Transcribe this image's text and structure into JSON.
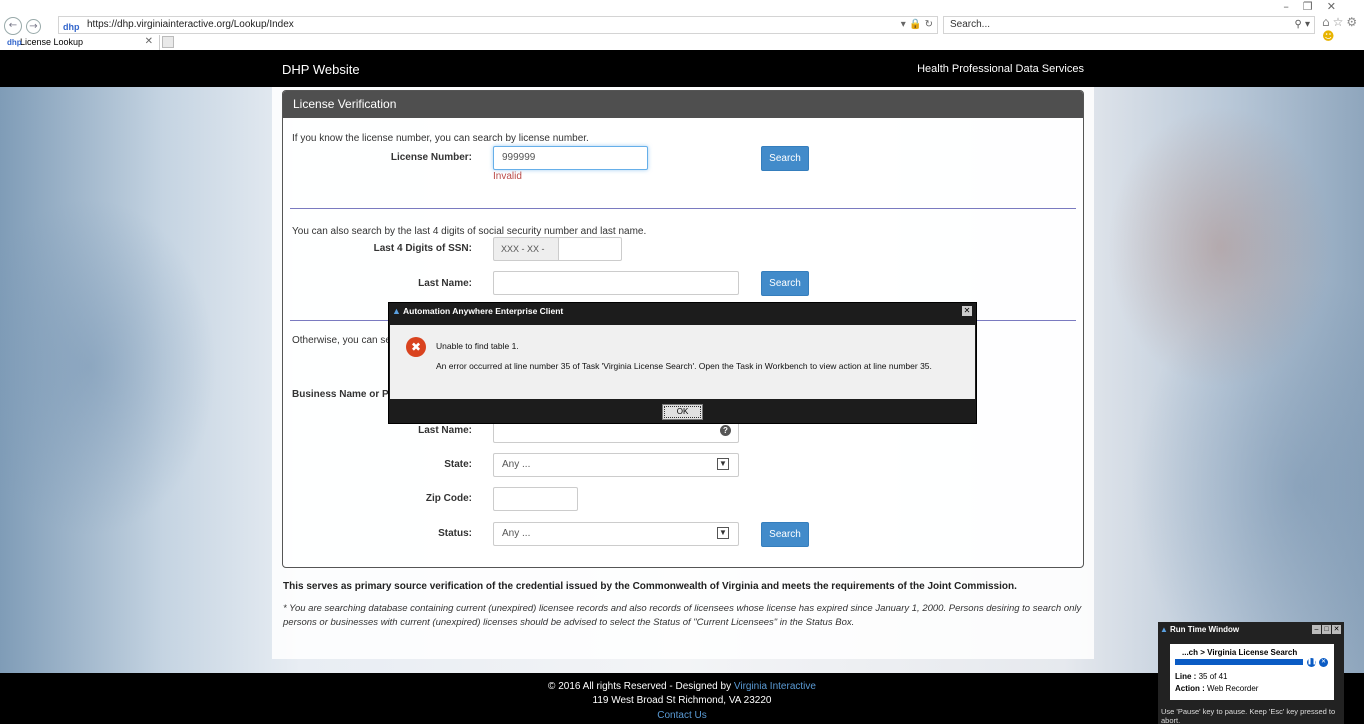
{
  "browser": {
    "url": "https://dhp.virginiainteractive.org/Lookup/Index",
    "search_placeholder": "Search...",
    "tab_title": "License Lookup"
  },
  "site": {
    "title": "DHP Website",
    "right_link": "Health Professional Data Services"
  },
  "form": {
    "heading": "License Verification",
    "section1_intro": "If you know the license number, you can search by license number.",
    "license_label": "License Number:",
    "license_value": "999999",
    "license_error": "Invalid",
    "search_label": "Search",
    "section2_intro": "You can also search by the last 4 digits of social security number and last name.",
    "ssn_label": "Last 4 Digits of SSN:",
    "ssn_prefix": "XXX - XX -",
    "lastname_label": "Last Name:",
    "section3_intro_partial": "Otherwise, you can se",
    "business_label_partial": "Business Name or P",
    "lastname3_label": "Last Name:",
    "state_label": "State:",
    "state_value": "Any ...",
    "zip_label": "Zip Code:",
    "status_label": "Status:",
    "status_value": "Any ..."
  },
  "notes": {
    "bold": "This serves as primary source verification of the credential issued by the Commonwealth of Virginia and meets the requirements of the Joint Commission.",
    "italic": "* You are searching database containing current (unexpired) licensee records and also records of licensees whose license has expired since January 1, 2000. Persons desiring to search only persons or businesses with current (unexpired) licenses should be advised to select the Status of \"Current Licensees\" in the Status Box."
  },
  "footer": {
    "copyright": "© 2016 All rights Reserved - Designed by",
    "designer": "Virginia Interactive",
    "address": "119 West Broad St Richmond, VA 23220",
    "contact": "Contact Us"
  },
  "dialog": {
    "title": "Automation Anywhere Enterprise Client",
    "message1": "Unable to find table 1.",
    "message2": "An error occurred at line number 35 of Task 'Virginia License Search'. Open the Task in Workbench to view action at line number 35.",
    "ok_label": "OK"
  },
  "runtime": {
    "title": "Run Time Window",
    "task": "...ch > Virginia License Search",
    "line_label": "Line :",
    "line_value": "35 of 41",
    "action_label": "Action :",
    "action_value": "Web Recorder",
    "hint": "Use 'Pause' key to pause. Keep 'Esc' key pressed to abort."
  }
}
